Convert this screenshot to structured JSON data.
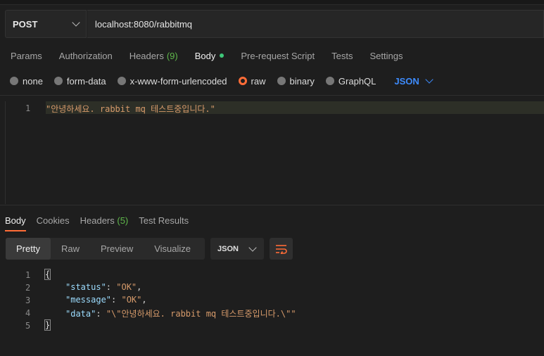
{
  "request": {
    "method": "POST",
    "url": "localhost:8080/rabbitmq"
  },
  "request_tabs": [
    {
      "label": "Params"
    },
    {
      "label": "Authorization"
    },
    {
      "label": "Headers",
      "count": "(9)"
    },
    {
      "label": "Body",
      "active": true
    },
    {
      "label": "Pre-request Script"
    },
    {
      "label": "Tests"
    },
    {
      "label": "Settings"
    }
  ],
  "body_types": [
    {
      "label": "none"
    },
    {
      "label": "form-data"
    },
    {
      "label": "x-www-form-urlencoded"
    },
    {
      "label": "raw",
      "selected": true
    },
    {
      "label": "binary"
    },
    {
      "label": "GraphQL"
    }
  ],
  "body_format": "JSON",
  "request_body": {
    "line_number": "1",
    "code": "\"안녕하세요. rabbit mq 테스트중입니다.\""
  },
  "response_tabs": [
    {
      "label": "Body",
      "active": true
    },
    {
      "label": "Cookies"
    },
    {
      "label": "Headers",
      "count": "(5)"
    },
    {
      "label": "Test Results"
    }
  ],
  "response_views": [
    {
      "label": "Pretty",
      "active": true
    },
    {
      "label": "Raw"
    },
    {
      "label": "Preview"
    },
    {
      "label": "Visualize"
    }
  ],
  "response_format": "JSON",
  "response_body": {
    "line_numbers": [
      "1",
      "2",
      "3",
      "4",
      "5"
    ],
    "open_brace": "{",
    "close_brace": "}",
    "fields": [
      {
        "key": "\"status\"",
        "value": "\"OK\"",
        "trail": ","
      },
      {
        "key": "\"message\"",
        "value": "\"OK\"",
        "trail": ","
      },
      {
        "key": "\"data\"",
        "value": "\"\\\"안녕하세요. rabbit mq 테스트중입니다.\\\"\"",
        "trail": ""
      }
    ]
  },
  "colors": {
    "accent": "#ff6c37",
    "count_green": "#5fb84b",
    "json_blue": "#3d8bfd",
    "string": "#d79b6b",
    "key": "#9cdcfe"
  }
}
